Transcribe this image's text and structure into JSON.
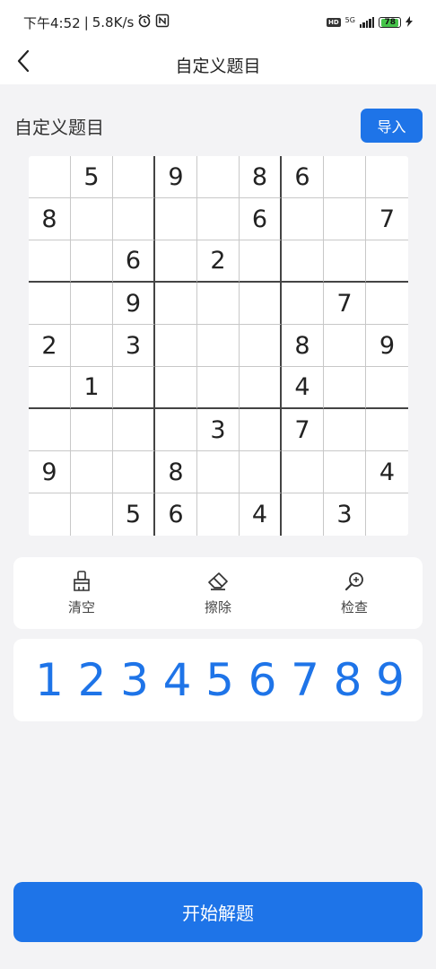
{
  "status_bar": {
    "time": "下午4:52",
    "speed": "5.8K/s",
    "alarm_icon": "alarm-icon",
    "nfc_icon": "nfc-icon",
    "hd": "HD",
    "network": "5G",
    "battery": "78"
  },
  "header": {
    "title": "自定义题目",
    "back_icon": "chevron-left-icon"
  },
  "section": {
    "title": "自定义题目",
    "import_label": "导入"
  },
  "board": {
    "rows": [
      [
        "",
        "5",
        "",
        "9",
        "",
        "8",
        "6",
        "",
        ""
      ],
      [
        "8",
        "",
        "",
        "",
        "",
        "6",
        "",
        "",
        "7"
      ],
      [
        "",
        "",
        "6",
        "",
        "2",
        "",
        "",
        "",
        ""
      ],
      [
        "",
        "",
        "9",
        "",
        "",
        "",
        "",
        "7",
        ""
      ],
      [
        "2",
        "",
        "3",
        "",
        "",
        "",
        "8",
        "",
        "9"
      ],
      [
        "",
        "1",
        "",
        "",
        "",
        "",
        "4",
        "",
        ""
      ],
      [
        "",
        "",
        "",
        "",
        "3",
        "",
        "7",
        "",
        ""
      ],
      [
        "9",
        "",
        "",
        "8",
        "",
        "",
        "",
        "",
        "4"
      ],
      [
        "",
        "",
        "5",
        "6",
        "",
        "4",
        "",
        "3",
        ""
      ]
    ]
  },
  "tools": [
    {
      "label": "清空",
      "icon": "brush-icon"
    },
    {
      "label": "擦除",
      "icon": "eraser-icon"
    },
    {
      "label": "检查",
      "icon": "magnifier-icon"
    }
  ],
  "numpad": [
    "1",
    "2",
    "3",
    "4",
    "5",
    "6",
    "7",
    "8",
    "9"
  ],
  "start_label": "开始解题",
  "colors": {
    "accent": "#1e74e8",
    "background": "#f3f3f5"
  }
}
